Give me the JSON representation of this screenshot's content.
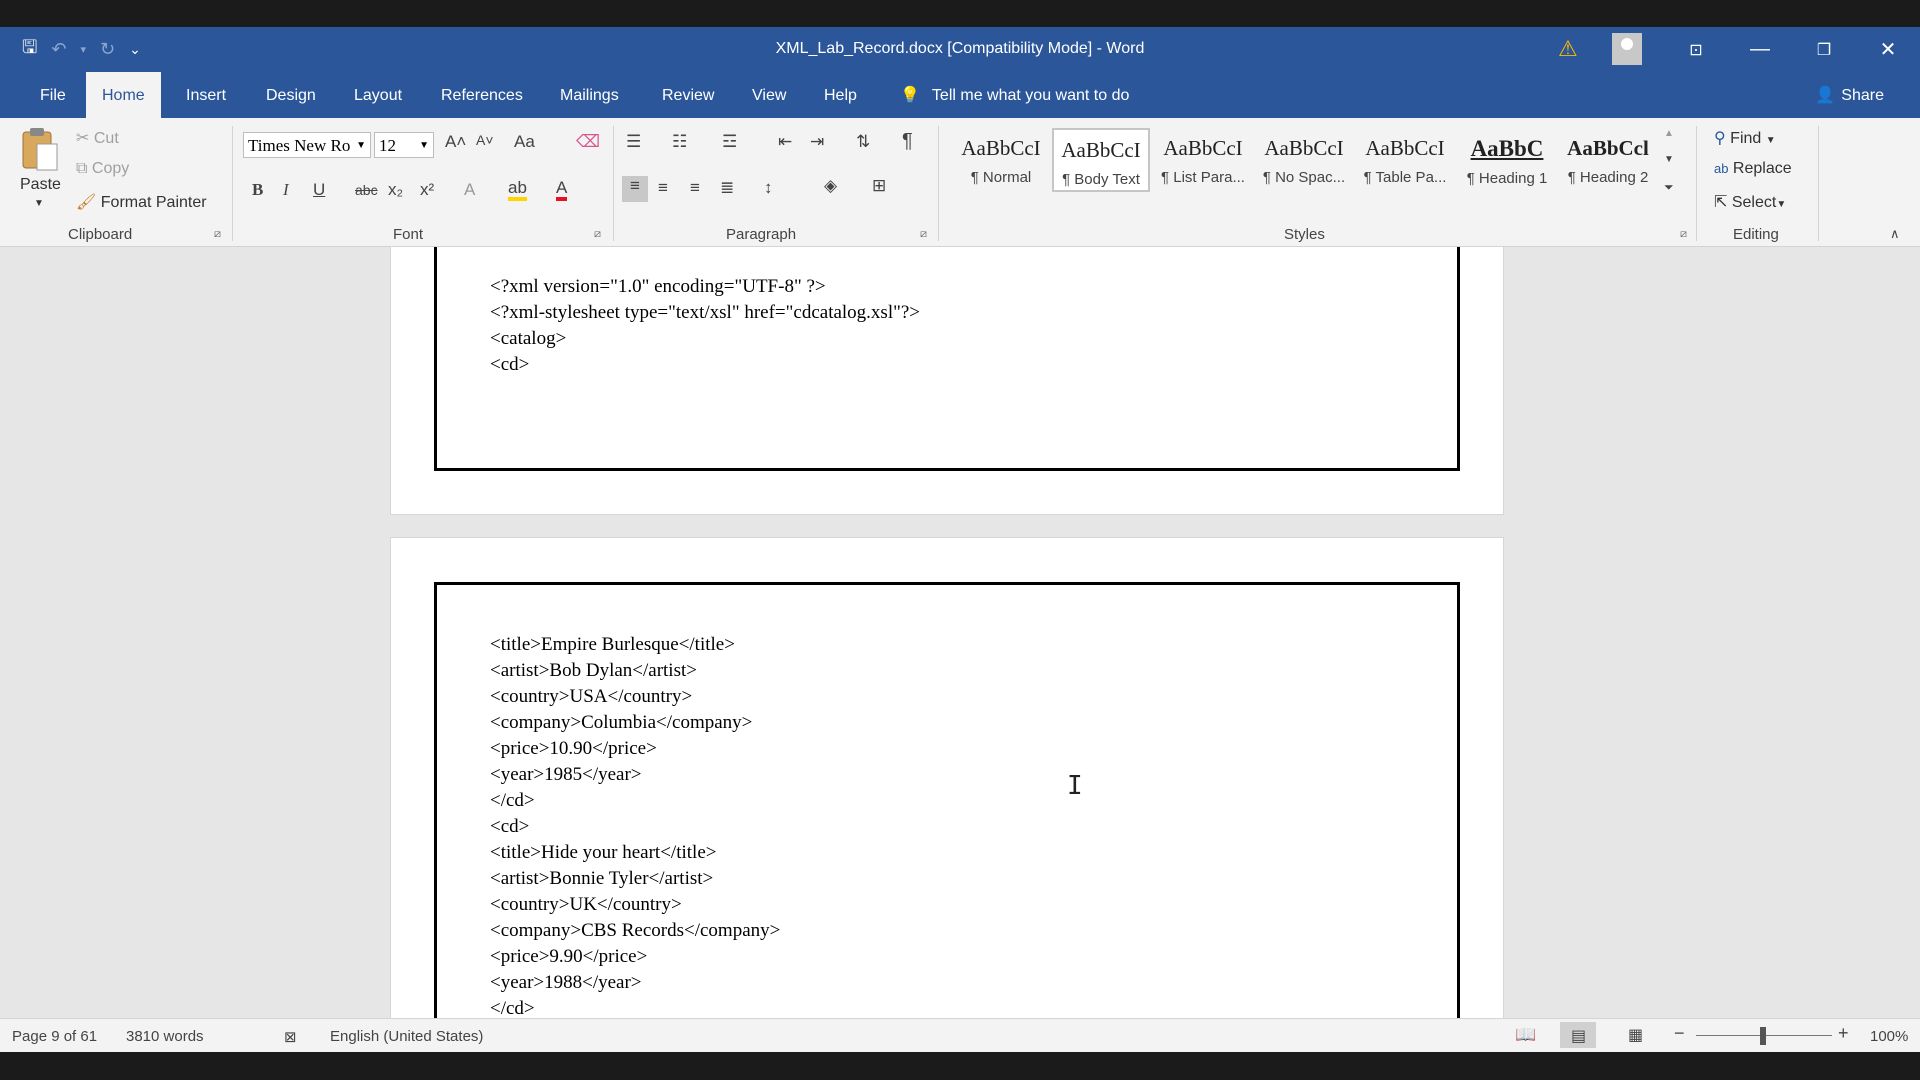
{
  "window": {
    "title": "XML_Lab_Record.docx [Compatibility Mode]  -  Word"
  },
  "quick_access": {
    "more_label": "⌄"
  },
  "tabs": {
    "file": "File",
    "home": "Home",
    "insert": "Insert",
    "design": "Design",
    "layout": "Layout",
    "references": "References",
    "mailings": "Mailings",
    "review": "Review",
    "view": "View",
    "help": "Help"
  },
  "tell_me": "Tell me what you want to do",
  "share": "Share",
  "clipboard": {
    "paste": "Paste",
    "cut": "Cut",
    "copy": "Copy",
    "format_painter": "Format Painter",
    "label": "Clipboard"
  },
  "font": {
    "name": "Times New Ro",
    "size": "12",
    "label": "Font",
    "bold": "B",
    "italic": "I",
    "underline": "U",
    "strike": "abc",
    "subscript": "x₂",
    "superscript": "x²",
    "grow": "A˄",
    "shrink": "A˅",
    "change_case": "Aa"
  },
  "paragraph": {
    "label": "Paragraph",
    "pilcrow": "¶"
  },
  "styles": {
    "label": "Styles",
    "items": [
      {
        "sample": "AaBbCcI",
        "name": "¶ Normal"
      },
      {
        "sample": "AaBbCcI",
        "name": "¶ Body Text"
      },
      {
        "sample": "AaBbCcI",
        "name": "¶ List Para..."
      },
      {
        "sample": "AaBbCcI",
        "name": "¶ No Spac..."
      },
      {
        "sample": "AaBbCcI",
        "name": "¶ Table Pa..."
      },
      {
        "sample": "AaBbC",
        "name": "¶ Heading 1"
      },
      {
        "sample": "AaBbCcl",
        "name": "¶ Heading 2"
      }
    ]
  },
  "editing": {
    "find": "Find",
    "replace": "Replace",
    "select": "Select",
    "label": "Editing"
  },
  "document": {
    "page1_lines": [
      "<?xml version=\"1.0\" encoding=\"UTF-8\" ?>",
      "<?xml-stylesheet type=\"text/xsl\" href=\"cdcatalog.xsl\"?>",
      "<catalog>",
      "<cd>"
    ],
    "page2_lines": [
      "<title>Empire Burlesque</title>",
      "<artist>Bob Dylan</artist>",
      "<country>USA</country>",
      "<company>Columbia</company>",
      "<price>10.90</price>",
      "<year>1985</year>",
      "</cd>",
      "<cd>",
      "<title>Hide your heart</title>",
      "<artist>Bonnie Tyler</artist>",
      "<country>UK</country>",
      "<company>CBS Records</company>",
      "<price>9.90</price>",
      "<year>1988</year>",
      "</cd>"
    ]
  },
  "status": {
    "page": "Page 9 of 61",
    "words": "3810 words",
    "language": "English (United States)",
    "zoom": "100%"
  },
  "colors": {
    "accent": "#2b579a",
    "warning": "#ffb900",
    "font_color": "#e81123",
    "highlight": "#ffd400"
  }
}
